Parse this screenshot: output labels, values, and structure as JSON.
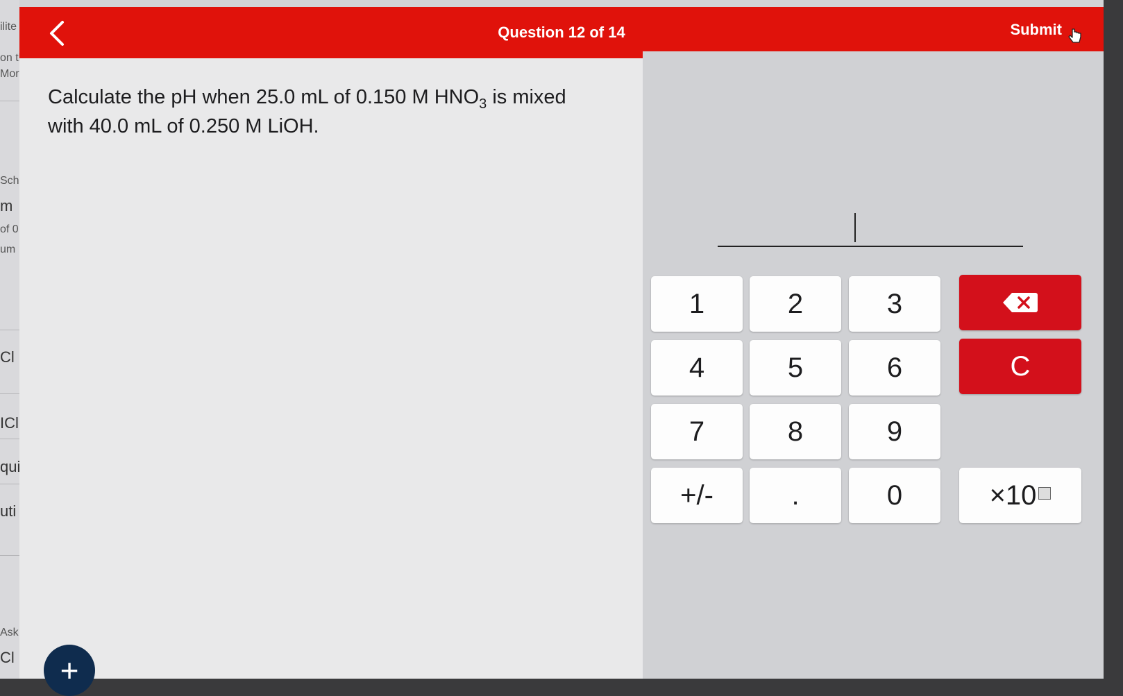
{
  "sidebar": {
    "fragments": [
      "ilite",
      "on th",
      "Mor",
      "Scho",
      "m",
      "of 0",
      "um",
      "Cl i",
      "ICl",
      "quir",
      "uti",
      "Ask",
      "Cl i"
    ]
  },
  "header": {
    "title": "Question 12 of 14",
    "submit_label": "Submit",
    "back_icon": "chevron-left-icon",
    "accent_color": "#e0120b"
  },
  "question": {
    "text_before": "Calculate the pH when 25.0 mL of 0.150 M HNO",
    "subscript": "3",
    "text_after": " is mixed with 40.0 mL of 0.250 M LiOH."
  },
  "answer": {
    "value": ""
  },
  "keypad": {
    "k1": "1",
    "k2": "2",
    "k3": "3",
    "k4": "4",
    "k5": "5",
    "k6": "6",
    "k7": "7",
    "k8": "8",
    "k9": "9",
    "plusminus": "+/-",
    "dot": ".",
    "k0": "0",
    "clear": "C",
    "times10": "×10",
    "backspace_icon": "backspace-icon",
    "button_red": "#d3101b"
  },
  "fab": {
    "label": "+",
    "color": "#0f2c4e"
  }
}
